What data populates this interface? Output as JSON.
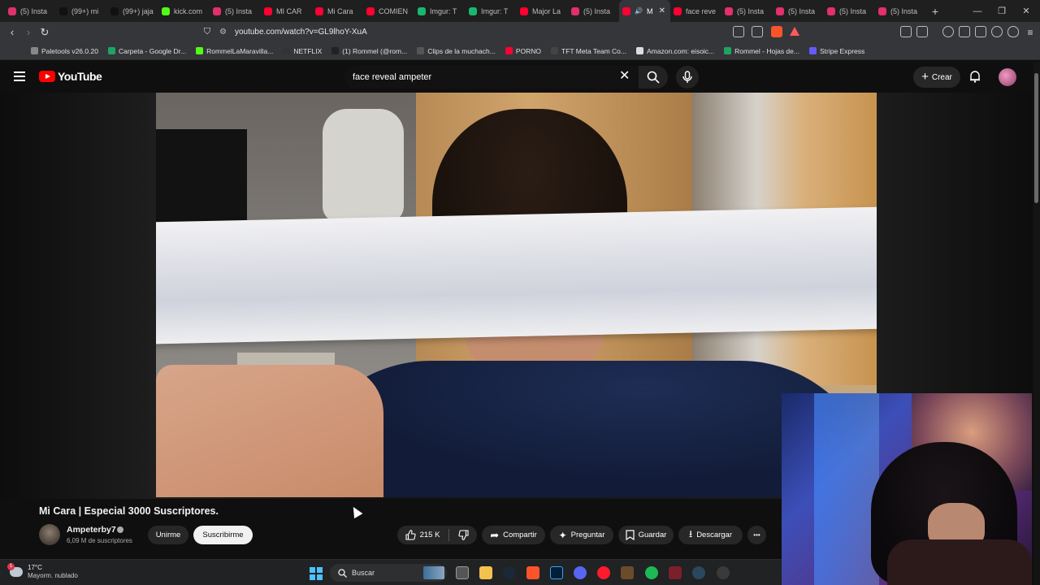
{
  "browser": {
    "tabs": [
      {
        "label": "(5) Insta",
        "color": "#e1306c"
      },
      {
        "label": "(99+) mi",
        "color": "#111111"
      },
      {
        "label": "(99+) jaja",
        "color": "#111111"
      },
      {
        "label": "kick.com",
        "color": "#53fc18"
      },
      {
        "label": "(5) Insta",
        "color": "#e1306c"
      },
      {
        "label": "MI CAR",
        "color": "#ff0033"
      },
      {
        "label": "Mi Cara",
        "color": "#ff0033"
      },
      {
        "label": "COMIEN",
        "color": "#ff0033"
      },
      {
        "label": "Imgur: T",
        "color": "#1bb76e"
      },
      {
        "label": "Imgur: T",
        "color": "#1bb76e"
      },
      {
        "label": "Major La",
        "color": "#ff0033"
      },
      {
        "label": "(5) Insta",
        "color": "#e1306c"
      },
      {
        "label": "M",
        "color": "#ff0033",
        "active": true
      },
      {
        "label": "face reve",
        "color": "#ff0033"
      },
      {
        "label": "(5) Insta",
        "color": "#e1306c"
      },
      {
        "label": "(5) Insta",
        "color": "#e1306c"
      },
      {
        "label": "(5) Insta",
        "color": "#e1306c"
      },
      {
        "label": "(5) Insta",
        "color": "#e1306c"
      }
    ],
    "new_tab": "+",
    "url": "youtube.com/watch?v=GL9lhoY-XuA",
    "bookmarks": [
      {
        "label": "Paletools v26.0.20",
        "color": "#888888"
      },
      {
        "label": "Carpeta - Google Dr...",
        "color": "#1fa463"
      },
      {
        "label": "RommelLaMaravilla...",
        "color": "#53fc18"
      },
      {
        "label": "NETFLIX",
        "color": "#333333"
      },
      {
        "label": "(1) Rommel (@rom...",
        "color": "#222222"
      },
      {
        "label": "Clips de la muchach...",
        "color": "#555555"
      },
      {
        "label": "PORNO",
        "color": "#ff0033"
      },
      {
        "label": "TFT Meta Team Co...",
        "color": "#444444"
      },
      {
        "label": "Amazon.com: eisoic...",
        "color": "#dddddd"
      },
      {
        "label": "Rommel - Hojas de...",
        "color": "#1fa463"
      },
      {
        "label": "Stripe Express",
        "color": "#635bff"
      }
    ]
  },
  "youtube": {
    "logo_text": "YouTube",
    "search_query": "face reveal ampeter",
    "create_label": "Crear",
    "video_title": "Mi Cara | Especial 3000 Suscriptores.",
    "channel_name": "Ampeterby7",
    "subscribers": "6,09 M de suscriptores",
    "join_label": "Unirme",
    "subscribe_label": "Suscribirme",
    "likes": "215 K",
    "share_label": "Compartir",
    "ask_label": "Preguntar",
    "save_label": "Guardar",
    "download_label": "Descargar",
    "more_label": "•••"
  },
  "taskbar": {
    "temperature": "17°C",
    "weather_desc": "Mayorm. nublado",
    "weather_badge": "1",
    "search_label": "Buscar"
  }
}
